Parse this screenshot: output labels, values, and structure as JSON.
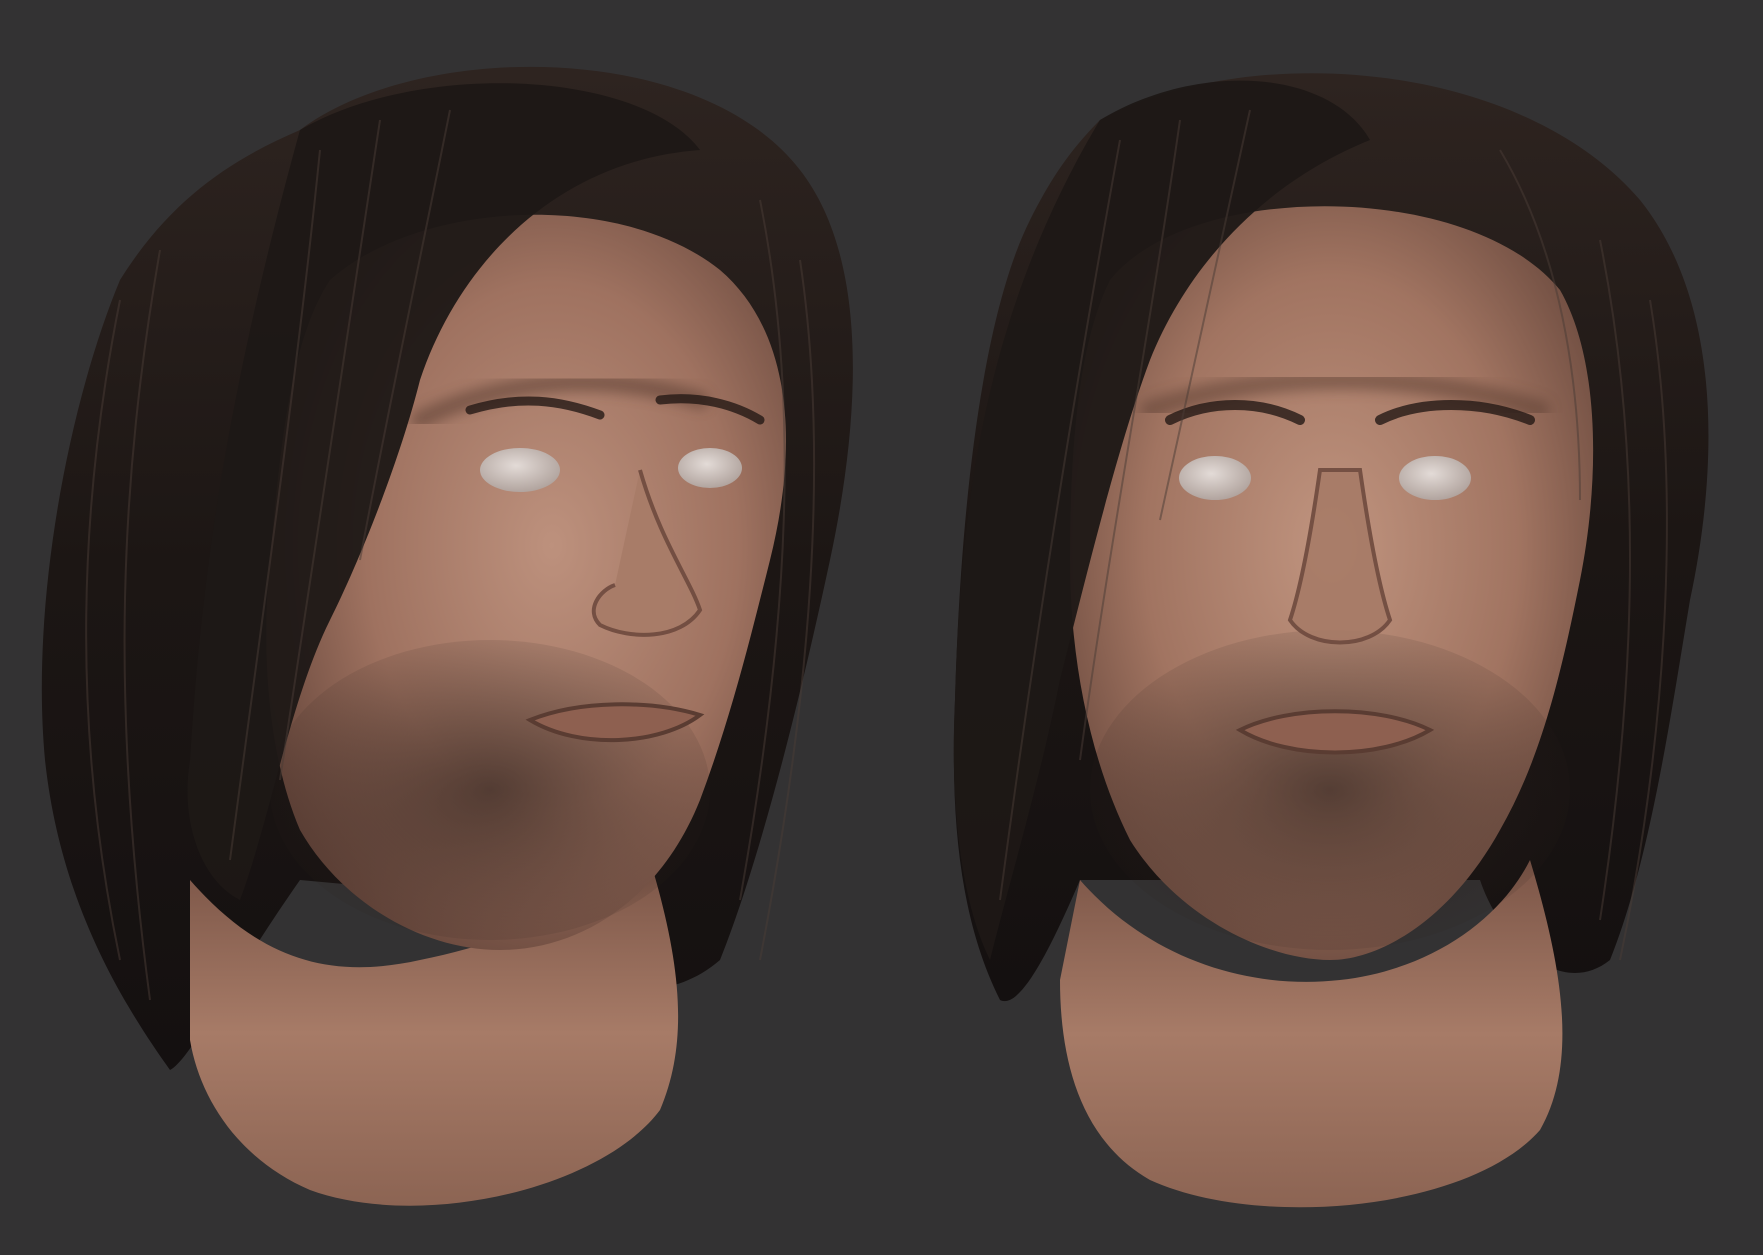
{
  "scene": {
    "description_free": true,
    "background_color": "#333233",
    "colors": {
      "skin_light": "#b68a77",
      "skin_mid": "#9a6e5c",
      "skin_dark": "#6e4a3e",
      "hair_dark": "#1c1614",
      "hair_mid": "#2e2420",
      "hair_highlight": "#5a4a44",
      "eye_white": "#cfc5c0",
      "stubble": "#2a1f1b"
    },
    "panels": [
      {
        "view": "three-quarter"
      },
      {
        "view": "front"
      }
    ]
  }
}
